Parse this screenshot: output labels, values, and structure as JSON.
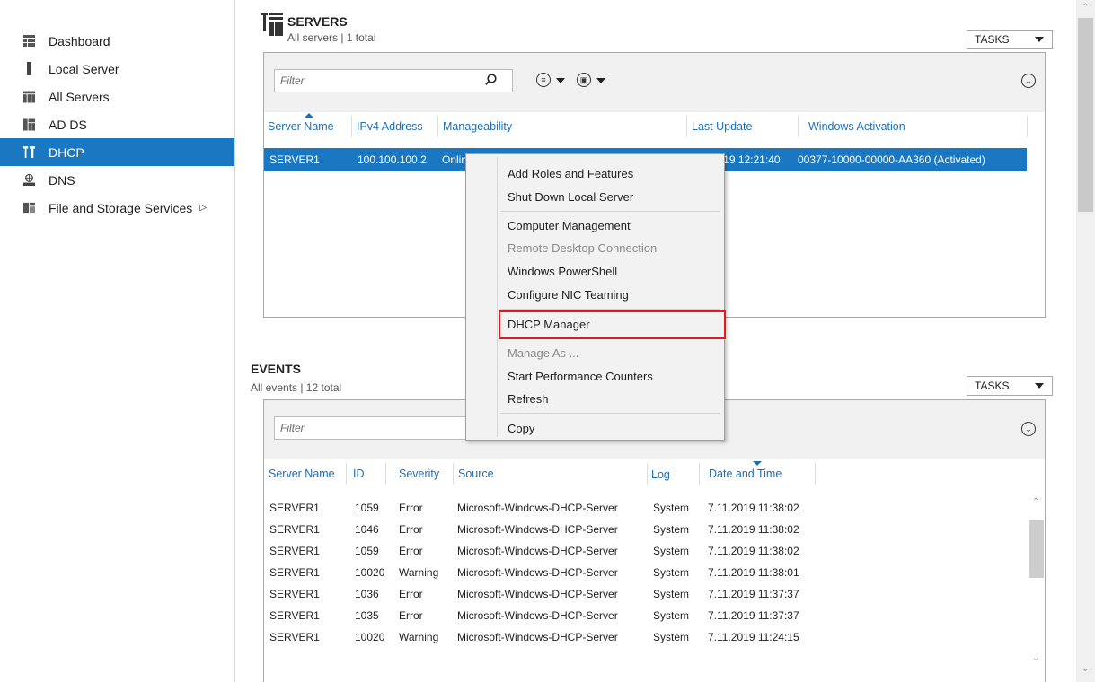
{
  "sidebar": {
    "items": [
      {
        "label": "Dashboard",
        "icon": "dashboard-icon"
      },
      {
        "label": "Local Server",
        "icon": "server-icon"
      },
      {
        "label": "All Servers",
        "icon": "servers-icon"
      },
      {
        "label": "AD DS",
        "icon": "ad-ds-icon"
      },
      {
        "label": "DHCP",
        "icon": "dhcp-icon",
        "active": true
      },
      {
        "label": "DNS",
        "icon": "dns-icon"
      },
      {
        "label": "File and Storage Services",
        "icon": "file-storage-icon",
        "has_submenu": true
      }
    ]
  },
  "servers": {
    "title": "SERVERS",
    "subtitle": "All servers | 1 total",
    "tasks_label": "TASKS",
    "filter_placeholder": "Filter",
    "columns": [
      "Server Name",
      "IPv4 Address",
      "Manageability",
      "Last Update",
      "Windows Activation"
    ],
    "row": {
      "server": "SERVER1",
      "ip": "100.100.100.2",
      "manageability": "Online - Performance counters not started",
      "last_update": "7.11.2019 12:21:40",
      "activation": "00377-10000-00000-AA360 (Activated)"
    }
  },
  "events": {
    "title": "EVENTS",
    "subtitle": "All events | 12 total",
    "tasks_label": "TASKS",
    "filter_placeholder": "Filter",
    "columns": [
      "Server Name",
      "ID",
      "Severity",
      "Source",
      "Log",
      "Date and Time"
    ],
    "rows": [
      [
        "SERVER1",
        "1059",
        "Error",
        "Microsoft-Windows-DHCP-Server",
        "System",
        "7.11.2019 11:38:02"
      ],
      [
        "SERVER1",
        "1046",
        "Error",
        "Microsoft-Windows-DHCP-Server",
        "System",
        "7.11.2019 11:38:02"
      ],
      [
        "SERVER1",
        "1059",
        "Error",
        "Microsoft-Windows-DHCP-Server",
        "System",
        "7.11.2019 11:38:02"
      ],
      [
        "SERVER1",
        "10020",
        "Warning",
        "Microsoft-Windows-DHCP-Server",
        "System",
        "7.11.2019 11:38:01"
      ],
      [
        "SERVER1",
        "1036",
        "Error",
        "Microsoft-Windows-DHCP-Server",
        "System",
        "7.11.2019 11:37:37"
      ],
      [
        "SERVER1",
        "1035",
        "Error",
        "Microsoft-Windows-DHCP-Server",
        "System",
        "7.11.2019 11:37:37"
      ],
      [
        "SERVER1",
        "10020",
        "Warning",
        "Microsoft-Windows-DHCP-Server",
        "System",
        "7.11.2019 11:24:15"
      ]
    ]
  },
  "context_menu": {
    "items": [
      {
        "label": "Add Roles and Features",
        "enabled": true
      },
      {
        "label": "Shut Down Local Server",
        "enabled": true
      },
      {
        "label": "Computer Management",
        "enabled": true
      },
      {
        "label": "Remote Desktop Connection",
        "enabled": false
      },
      {
        "label": "Windows PowerShell",
        "enabled": true
      },
      {
        "label": "Configure NIC Teaming",
        "enabled": true
      },
      {
        "label": "DHCP Manager",
        "enabled": true,
        "highlighted": true
      },
      {
        "label": "Manage As ...",
        "enabled": false
      },
      {
        "label": "Start Performance Counters",
        "enabled": true
      },
      {
        "label": "Refresh",
        "enabled": true
      },
      {
        "label": "Copy",
        "enabled": true
      }
    ]
  },
  "colors": {
    "selection": "#1a78c2",
    "highlight_border": "#e01b1b",
    "header_link": "#1e6fb5"
  }
}
